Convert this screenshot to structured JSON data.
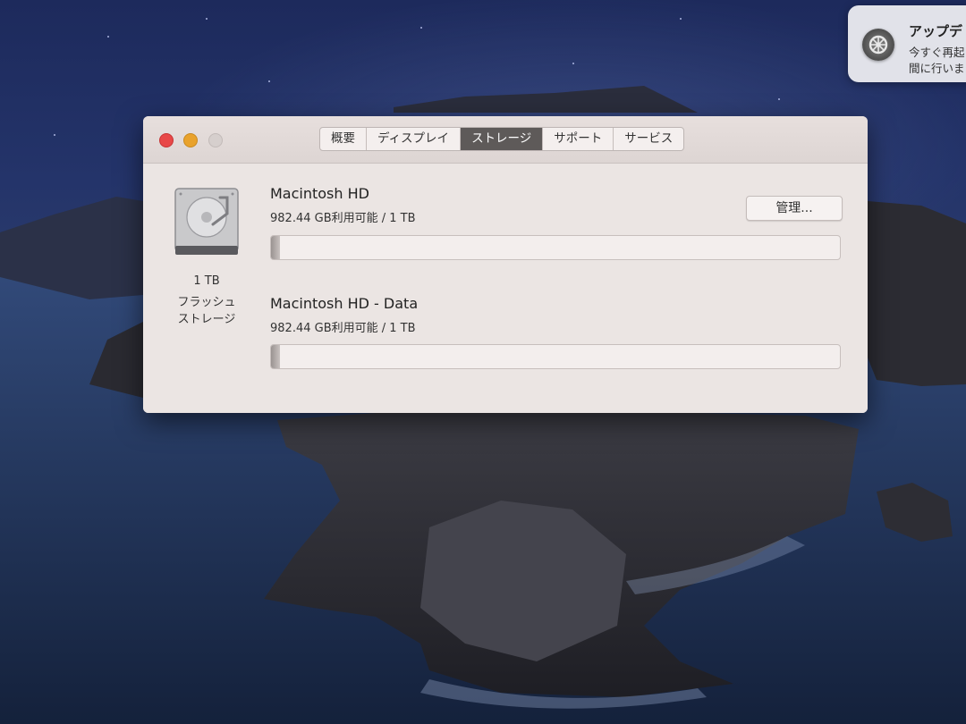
{
  "notification": {
    "title": "アップデ",
    "line1": "今すぐ再起",
    "line2": "間に行いま"
  },
  "window": {
    "tabs": [
      {
        "label": "概要",
        "active": false
      },
      {
        "label": "ディスプレイ",
        "active": false
      },
      {
        "label": "ストレージ",
        "active": true
      },
      {
        "label": "サポート",
        "active": false
      },
      {
        "label": "サービス",
        "active": false
      }
    ],
    "disk": {
      "capacity": "1 TB",
      "type_line1": "フラッシュ",
      "type_line2": "ストレージ"
    },
    "volumes": [
      {
        "name": "Macintosh HD",
        "info": "982.44 GB利用可能 / 1 TB",
        "used_fraction": 0.015
      },
      {
        "name": "Macintosh HD - Data",
        "info": "982.44 GB利用可能 / 1 TB",
        "used_fraction": 0.015
      }
    ],
    "manage_label": "管理..."
  },
  "colors": {
    "close": "#e84848",
    "minimize": "#e9a22c",
    "active_tab": "#5e5a59"
  }
}
